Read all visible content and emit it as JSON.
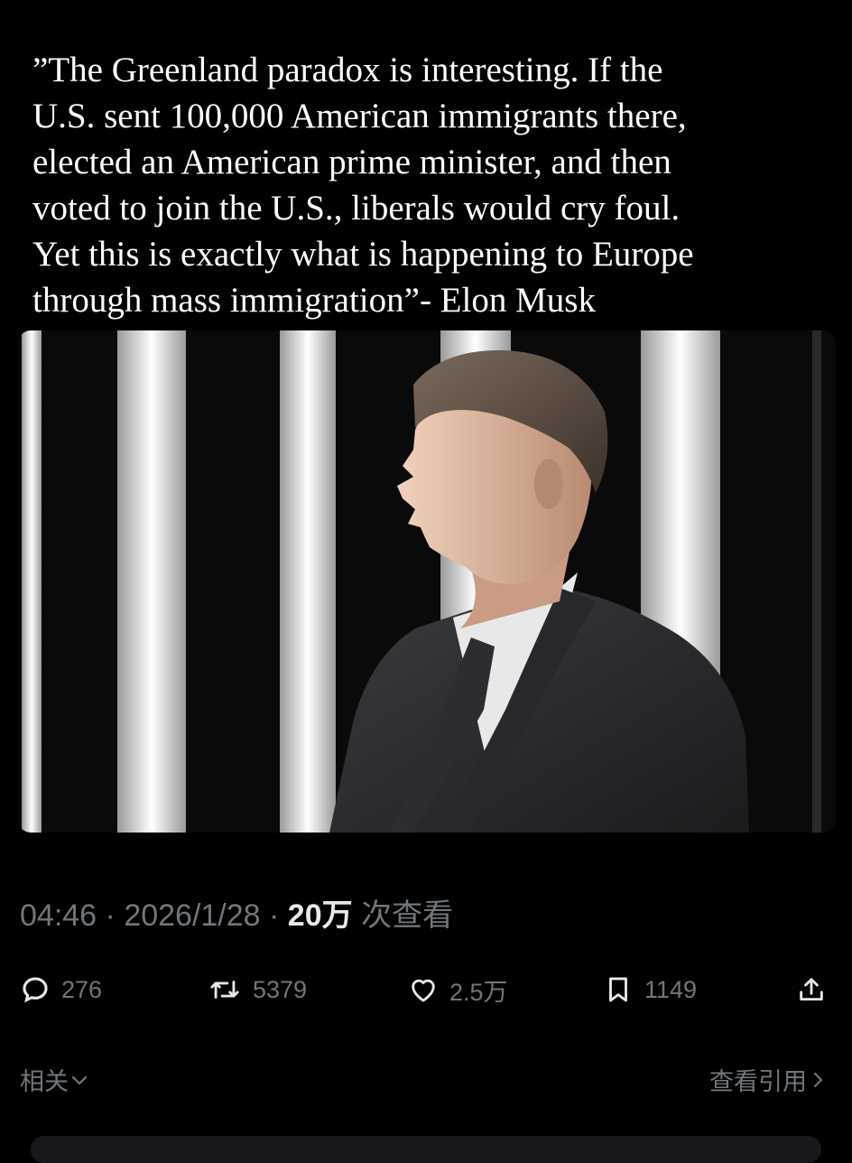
{
  "tweet": {
    "quote_lines": [
      "”The Greenland paradox is interesting. If the",
      "U.S. sent 100,000 American immigrants there,",
      "elected an American prime minister, and then",
      "voted to join the U.S., liberals would cry foul.",
      "Yet this is exactly what is happening to Europe",
      "through mass immigration”- Elon Musk"
    ]
  },
  "meta": {
    "time": "04:46",
    "sep1": " · ",
    "date": "2026/1/28",
    "sep2": " · ",
    "views": "20万",
    "views_label": " 次查看"
  },
  "actions": {
    "reply": {
      "icon": "reply-icon",
      "count": "276"
    },
    "retweet": {
      "icon": "retweet-icon",
      "count": "5379"
    },
    "like": {
      "icon": "heart-icon",
      "count": "2.5万"
    },
    "bookmark": {
      "icon": "bookmark-icon",
      "count": "1149"
    },
    "share": {
      "icon": "share-icon"
    }
  },
  "footer": {
    "related_label": "相关",
    "quotes_label": "查看引用"
  },
  "colors": {
    "background": "#000000",
    "text": "#e7e9ea",
    "muted": "#71767b"
  }
}
